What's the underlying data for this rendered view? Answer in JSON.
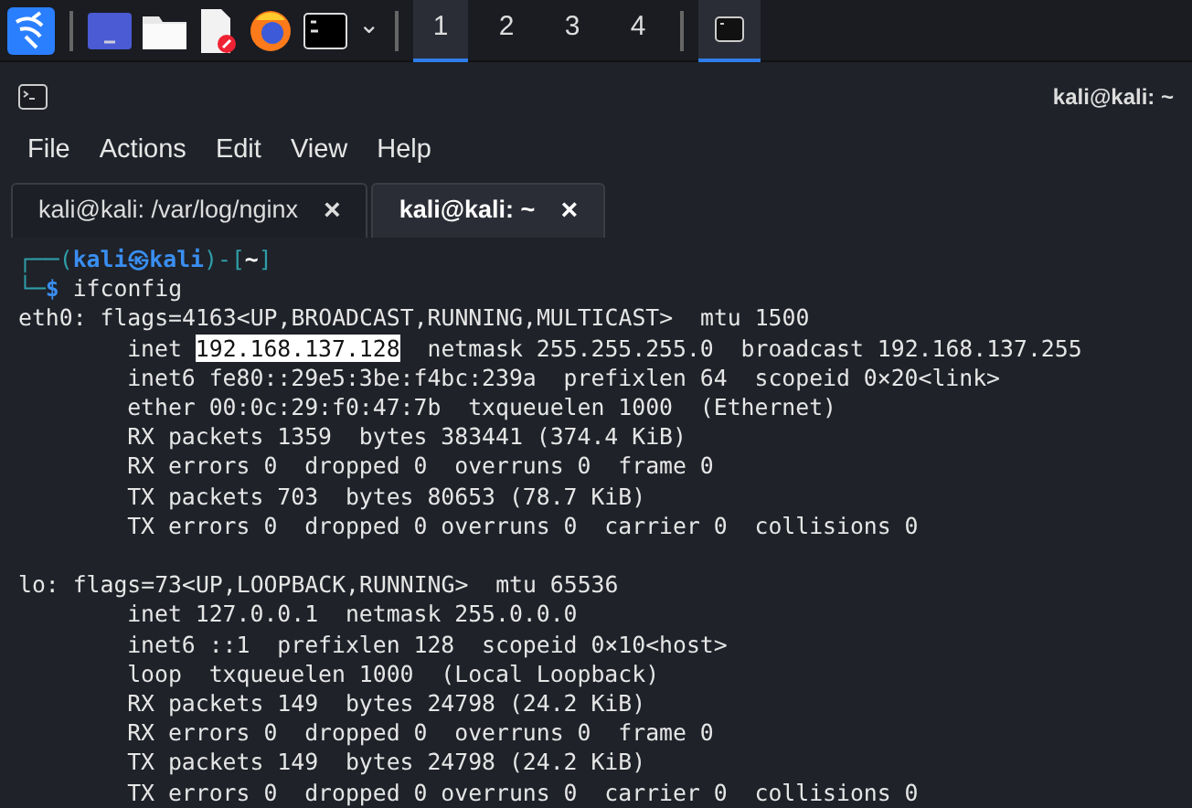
{
  "taskbar": {
    "launchers": [
      {
        "kind": "kali"
      },
      {
        "kind": "desktop"
      },
      {
        "kind": "folder"
      },
      {
        "kind": "editor"
      },
      {
        "kind": "browser"
      },
      {
        "kind": "terminal"
      }
    ],
    "chevron": "⌄",
    "workspaces": [
      {
        "label": "1",
        "selected": true
      },
      {
        "label": "2",
        "selected": false
      },
      {
        "label": "3",
        "selected": false
      },
      {
        "label": "4",
        "selected": false
      }
    ],
    "tasks": [
      {
        "kind": "terminal",
        "selected": true
      }
    ]
  },
  "window": {
    "title": "kali@kali: ~"
  },
  "menu": [
    "File",
    "Actions",
    "Edit",
    "View",
    "Help"
  ],
  "tabs": [
    {
      "label": "kali@kali: /var/log/nginx",
      "close": "×",
      "selected": false
    },
    {
      "label": "kali@kali: ~",
      "close": "×",
      "selected": true
    }
  ],
  "terminal": {
    "prompt": {
      "top_parts": [
        {
          "text": "┌──(",
          "kind": "frame"
        },
        {
          "text": "kali㉿kali",
          "kind": "user"
        },
        {
          "text": ")-[",
          "kind": "frame"
        },
        {
          "text": "~",
          "kind": "path"
        },
        {
          "text": "]",
          "kind": "frame"
        }
      ],
      "bottom_parts": [
        {
          "text": "└─",
          "kind": "frame"
        },
        {
          "text": "$",
          "kind": "symbol"
        },
        {
          "text": " ifconfig",
          "kind": "command"
        }
      ]
    },
    "interfaces": [
      {
        "header": "eth0: flags=4163<UP,BROADCAST,RUNNING,MULTICAST>  mtu 1500",
        "lines": [
          {
            "parts": [
              {
                "text": "inet ",
                "selected": false
              },
              {
                "text": "192.168.137.128",
                "selected": true
              },
              {
                "text": "  netmask 255.255.255.0  broadcast 192.168.137.255",
                "selected": false
              }
            ]
          },
          {
            "parts": [
              {
                "text": "inet6 fe80::29e5:3be:f4bc:239a  prefixlen 64  scopeid 0×20<link>",
                "selected": false
              }
            ]
          },
          {
            "parts": [
              {
                "text": "ether 00:0c:29:f0:47:7b  txqueuelen 1000  (Ethernet)",
                "selected": false
              }
            ]
          },
          {
            "parts": [
              {
                "text": "RX packets 1359  bytes 383441 (374.4 KiB)",
                "selected": false
              }
            ]
          },
          {
            "parts": [
              {
                "text": "RX errors 0  dropped 0  overruns 0  frame 0",
                "selected": false
              }
            ]
          },
          {
            "parts": [
              {
                "text": "TX packets 703  bytes 80653 (78.7 KiB)",
                "selected": false
              }
            ]
          },
          {
            "parts": [
              {
                "text": "TX errors 0  dropped 0 overruns 0  carrier 0  collisions 0",
                "selected": false
              }
            ]
          }
        ]
      },
      {
        "header": "lo: flags=73<UP,LOOPBACK,RUNNING>  mtu 65536",
        "lines": [
          {
            "parts": [
              {
                "text": "inet 127.0.0.1  netmask 255.0.0.0",
                "selected": false
              }
            ]
          },
          {
            "parts": [
              {
                "text": "inet6 ::1  prefixlen 128  scopeid 0×10<host>",
                "selected": false
              }
            ]
          },
          {
            "parts": [
              {
                "text": "loop  txqueuelen 1000  (Local Loopback)",
                "selected": false
              }
            ]
          },
          {
            "parts": [
              {
                "text": "RX packets 149  bytes 24798 (24.2 KiB)",
                "selected": false
              }
            ]
          },
          {
            "parts": [
              {
                "text": "RX errors 0  dropped 0  overruns 0  frame 0",
                "selected": false
              }
            ]
          },
          {
            "parts": [
              {
                "text": "TX packets 149  bytes 24798 (24.2 KiB)",
                "selected": false
              }
            ]
          },
          {
            "parts": [
              {
                "text": "TX errors 0  dropped 0 overruns 0  carrier 0  collisions 0",
                "selected": false
              }
            ]
          }
        ]
      }
    ]
  }
}
